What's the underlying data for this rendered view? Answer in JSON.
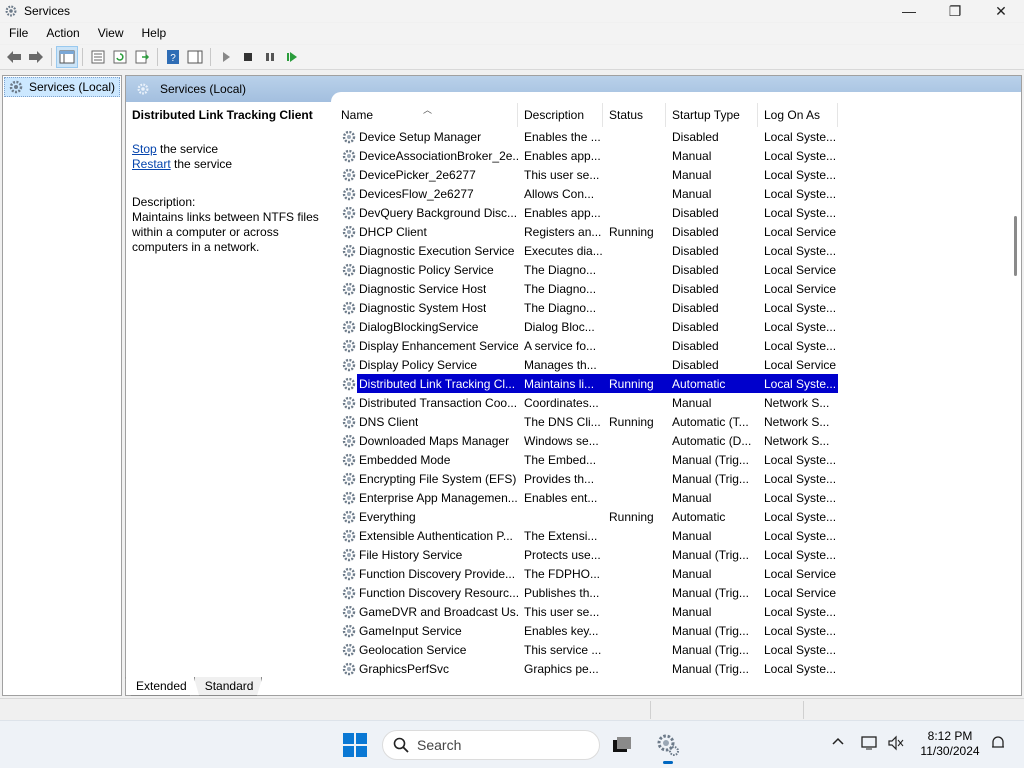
{
  "window": {
    "title": "Services",
    "controls": {
      "minimize": "—",
      "maximize": "❐",
      "close": "✕"
    }
  },
  "menu": [
    "File",
    "Action",
    "View",
    "Help"
  ],
  "tree": {
    "root_label": "Services (Local)"
  },
  "pane": {
    "header": "Services (Local)",
    "selected_title": "Distributed Link Tracking Client",
    "stop_link": "Stop",
    "stop_suffix": " the service",
    "restart_link": "Restart",
    "restart_suffix": " the service",
    "description_label": "Description:",
    "description_text": "Maintains links between NTFS files within a computer or across computers in a network."
  },
  "columns": [
    "Name",
    "Description",
    "Status",
    "Startup Type",
    "Log On As"
  ],
  "rows": [
    {
      "name": "Device Setup Manager",
      "desc": "Enables the ...",
      "status": "",
      "startup": "Disabled",
      "logon": "Local Syste..."
    },
    {
      "name": "DeviceAssociationBroker_2e...",
      "desc": "Enables app...",
      "status": "",
      "startup": "Manual",
      "logon": "Local Syste..."
    },
    {
      "name": "DevicePicker_2e6277",
      "desc": "This user se...",
      "status": "",
      "startup": "Manual",
      "logon": "Local Syste..."
    },
    {
      "name": "DevicesFlow_2e6277",
      "desc": "Allows Con...",
      "status": "",
      "startup": "Manual",
      "logon": "Local Syste..."
    },
    {
      "name": "DevQuery Background Disc...",
      "desc": "Enables app...",
      "status": "",
      "startup": "Disabled",
      "logon": "Local Syste..."
    },
    {
      "name": "DHCP Client",
      "desc": "Registers an...",
      "status": "Running",
      "startup": "Disabled",
      "logon": "Local Service"
    },
    {
      "name": "Diagnostic Execution Service",
      "desc": "Executes dia...",
      "status": "",
      "startup": "Disabled",
      "logon": "Local Syste..."
    },
    {
      "name": "Diagnostic Policy Service",
      "desc": "The Diagno...",
      "status": "",
      "startup": "Disabled",
      "logon": "Local Service"
    },
    {
      "name": "Diagnostic Service Host",
      "desc": "The Diagno...",
      "status": "",
      "startup": "Disabled",
      "logon": "Local Service"
    },
    {
      "name": "Diagnostic System Host",
      "desc": "The Diagno...",
      "status": "",
      "startup": "Disabled",
      "logon": "Local Syste..."
    },
    {
      "name": "DialogBlockingService",
      "desc": "Dialog Bloc...",
      "status": "",
      "startup": "Disabled",
      "logon": "Local Syste..."
    },
    {
      "name": "Display Enhancement Service",
      "desc": "A service fo...",
      "status": "",
      "startup": "Disabled",
      "logon": "Local Syste..."
    },
    {
      "name": "Display Policy Service",
      "desc": "Manages th...",
      "status": "",
      "startup": "Disabled",
      "logon": "Local Service"
    },
    {
      "name": "Distributed Link Tracking Cl...",
      "desc": "Maintains li...",
      "status": "Running",
      "startup": "Automatic",
      "logon": "Local Syste...",
      "selected": true
    },
    {
      "name": "Distributed Transaction Coo...",
      "desc": "Coordinates...",
      "status": "",
      "startup": "Manual",
      "logon": "Network S..."
    },
    {
      "name": "DNS Client",
      "desc": "The DNS Cli...",
      "status": "Running",
      "startup": "Automatic (T...",
      "logon": "Network S..."
    },
    {
      "name": "Downloaded Maps Manager",
      "desc": "Windows se...",
      "status": "",
      "startup": "Automatic (D...",
      "logon": "Network S..."
    },
    {
      "name": "Embedded Mode",
      "desc": "The Embed...",
      "status": "",
      "startup": "Manual (Trig...",
      "logon": "Local Syste..."
    },
    {
      "name": "Encrypting File System (EFS)",
      "desc": "Provides th...",
      "status": "",
      "startup": "Manual (Trig...",
      "logon": "Local Syste..."
    },
    {
      "name": "Enterprise App Managemen...",
      "desc": "Enables ent...",
      "status": "",
      "startup": "Manual",
      "logon": "Local Syste..."
    },
    {
      "name": "Everything",
      "desc": "",
      "status": "Running",
      "startup": "Automatic",
      "logon": "Local Syste..."
    },
    {
      "name": "Extensible Authentication P...",
      "desc": "The Extensi...",
      "status": "",
      "startup": "Manual",
      "logon": "Local Syste..."
    },
    {
      "name": "File History Service",
      "desc": "Protects use...",
      "status": "",
      "startup": "Manual (Trig...",
      "logon": "Local Syste..."
    },
    {
      "name": "Function Discovery Provide...",
      "desc": "The FDPHO...",
      "status": "",
      "startup": "Manual",
      "logon": "Local Service"
    },
    {
      "name": "Function Discovery Resourc...",
      "desc": "Publishes th...",
      "status": "",
      "startup": "Manual (Trig...",
      "logon": "Local Service"
    },
    {
      "name": "GameDVR and Broadcast Us...",
      "desc": "This user se...",
      "status": "",
      "startup": "Manual",
      "logon": "Local Syste..."
    },
    {
      "name": "GameInput Service",
      "desc": "Enables key...",
      "status": "",
      "startup": "Manual (Trig...",
      "logon": "Local Syste..."
    },
    {
      "name": "Geolocation Service",
      "desc": "This service ...",
      "status": "",
      "startup": "Manual (Trig...",
      "logon": "Local Syste..."
    },
    {
      "name": "GraphicsPerfSvc",
      "desc": "Graphics pe...",
      "status": "",
      "startup": "Manual (Trig...",
      "logon": "Local Syste..."
    }
  ],
  "tabs": [
    "Extended",
    "Standard"
  ],
  "taskbar": {
    "search_placeholder": "Search",
    "time": "8:12 PM",
    "date": "11/30/2024"
  },
  "colors": {
    "selection": "#0000cc",
    "link": "#0645ad",
    "header_gradient": "#b9d1ea"
  }
}
